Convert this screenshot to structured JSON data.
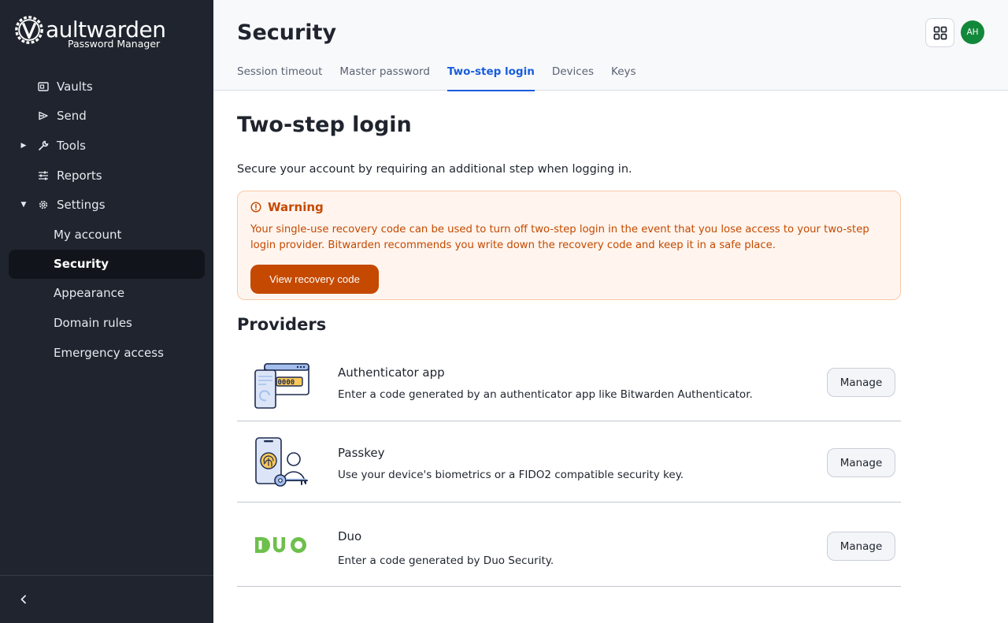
{
  "brand": {
    "name": "aultwarden",
    "subtitle": "Password Manager"
  },
  "sidebar": {
    "items": [
      {
        "label": "Vaults",
        "icon": "vault-icon"
      },
      {
        "label": "Send",
        "icon": "send-icon"
      },
      {
        "label": "Tools",
        "icon": "wrench-icon",
        "caret": "collapsed"
      },
      {
        "label": "Reports",
        "icon": "sliders-icon"
      },
      {
        "label": "Settings",
        "icon": "gear-icon",
        "caret": "expanded"
      }
    ],
    "settings_children": [
      {
        "label": "My account"
      },
      {
        "label": "Security",
        "active": true
      },
      {
        "label": "Appearance"
      },
      {
        "label": "Domain rules"
      },
      {
        "label": "Emergency access"
      }
    ]
  },
  "header": {
    "title": "Security",
    "avatar_initials": "AH",
    "tabs": [
      {
        "label": "Session timeout"
      },
      {
        "label": "Master password"
      },
      {
        "label": "Two-step login",
        "active": true
      },
      {
        "label": "Devices"
      },
      {
        "label": "Keys"
      }
    ]
  },
  "main": {
    "title": "Two-step login",
    "intro": "Secure your account by requiring an additional step when logging in.",
    "warning": {
      "title": "Warning",
      "text": "Your single-use recovery code can be used to turn off two-step login in the event that you lose access to your two-step login provider. Bitwarden recommends you write down the recovery code and keep it in a safe place.",
      "button": "View recovery code"
    },
    "providers_title": "Providers",
    "providers": [
      {
        "name": "Authenticator app",
        "description": "Enter a code generated by an authenticator app like Bitwarden Authenticator.",
        "button": "Manage"
      },
      {
        "name": "Passkey",
        "description": "Use your device's biometrics or a FIDO2 compatible security key.",
        "button": "Manage"
      },
      {
        "name": "Duo",
        "description": "Enter a code generated by Duo Security.",
        "button": "Manage"
      }
    ]
  },
  "colors": {
    "sidebar_bg": "#1f242e",
    "accent": "#175ddc",
    "warning": "#c54900",
    "warning_bg": "#fff5ee",
    "duo_green": "#6dc04b",
    "avatar": "#12883a"
  }
}
